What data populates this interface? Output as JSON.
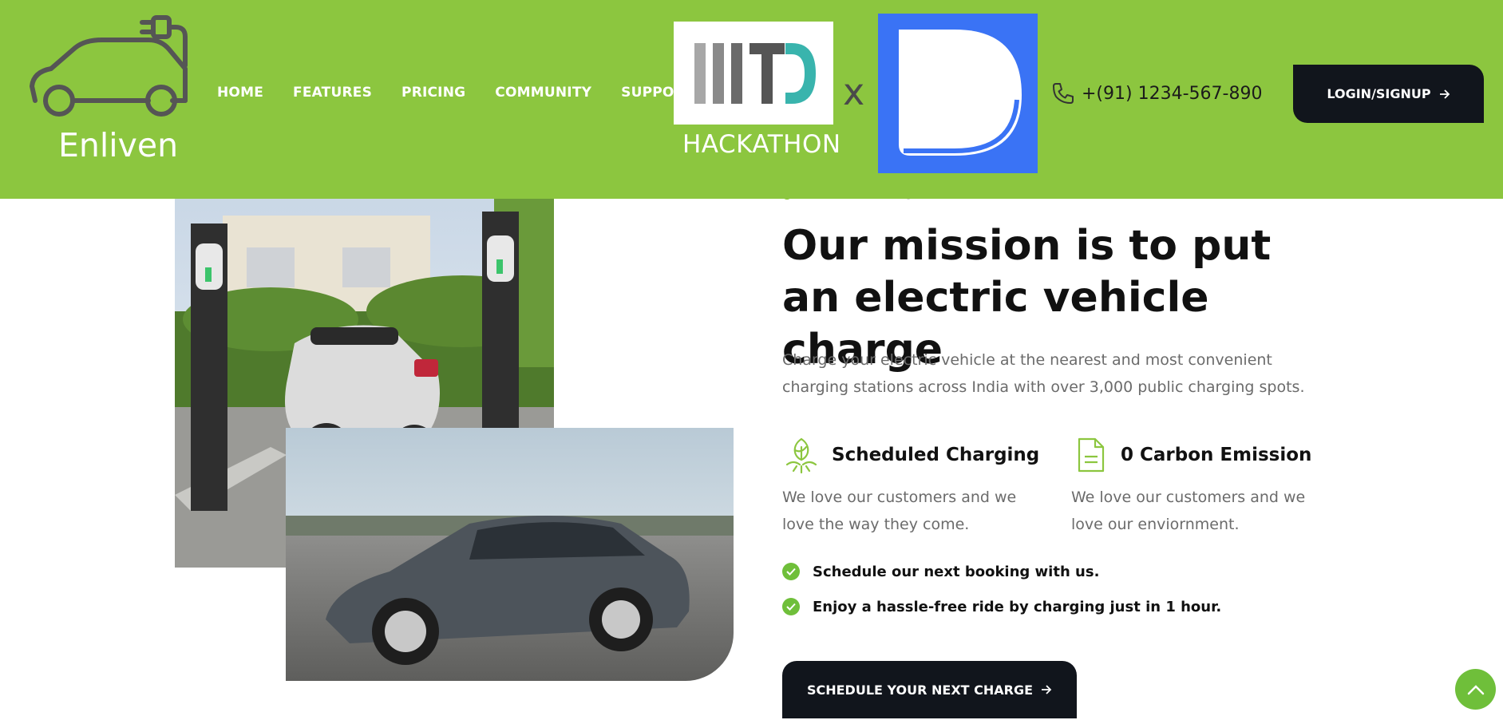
{
  "colors": {
    "header_bg": "#8cc63f",
    "accent": "#6fbf3a",
    "dark_button": "#11151c",
    "partner_blue": "#3a73f5"
  },
  "header": {
    "brand": "Enliven",
    "logo_icon": "ev-car-plug-icon",
    "nav": [
      "HOME",
      "FEATURES",
      "PRICING",
      "COMMUNITY",
      "SUPPORT"
    ],
    "partner_label": "HACKATHON",
    "cross": "x",
    "phone_icon": "phone-icon",
    "phone": "+(91) 1234-567-890",
    "login_label": "LOGIN/SIGNUP",
    "login_icon": "arrow-right-icon"
  },
  "about": {
    "eyebrow": "WHAT WE DO?",
    "heading": "Our mission is to put an electric vehicle charge",
    "lead": "Charge your electric vehicle at the nearest and most convenient charging stations across India with over 3,000 public charging spots.",
    "features": [
      {
        "icon": "charging-plant-icon",
        "title": "Scheduled Charging",
        "text": "We love our customers and we love the way they come."
      },
      {
        "icon": "document-icon",
        "title": "0 Carbon Emission",
        "text": "We love our customers and we love our enviornment."
      }
    ],
    "checklist": [
      "Schedule our next booking with us.",
      "Enjoy a hassle-free ride by charging just in 1 hour."
    ],
    "cta_label": "SCHEDULE YOUR NEXT CHARGE",
    "cta_icon": "arrow-right-icon"
  },
  "images": {
    "scooter": "scooter-charging-station-photo",
    "car": "electric-sedan-photo"
  },
  "scroll_top_icon": "chevron-up-icon"
}
